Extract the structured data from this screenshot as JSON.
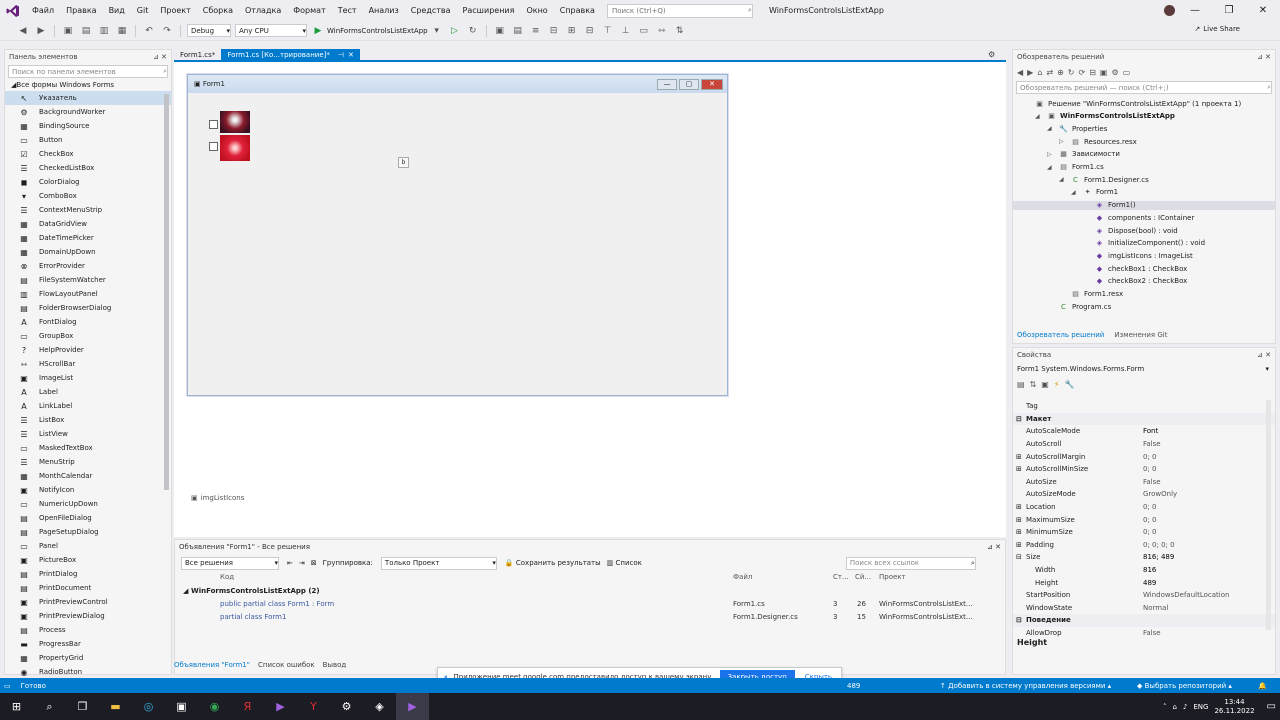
{
  "menu": [
    "Файл",
    "Правка",
    "Вид",
    "Git",
    "Проект",
    "Сборка",
    "Отладка",
    "Формат",
    "Тест",
    "Анализ",
    "Средства",
    "Расширения",
    "Окно",
    "Справка"
  ],
  "search": {
    "placeholder": "Поиск (Ctrl+Q)"
  },
  "app_title": "WinFormsControlsListExtApp",
  "window_controls": [
    "—",
    "❐",
    "✕"
  ],
  "toolbar": {
    "config": "Debug",
    "platform": "Any CPU",
    "run_label": "WinFormsControlsListExtApp",
    "live_share": "Live Share"
  },
  "toolbox": {
    "title": "Панель элементов",
    "search_placeholder": "Поиск по панели элементов",
    "group": "Все формы Windows Forms",
    "items": [
      "Указатель",
      "BackgroundWorker",
      "BindingSource",
      "Button",
      "CheckBox",
      "CheckedListBox",
      "ColorDialog",
      "ComboBox",
      "ContextMenuStrip",
      "DataGridView",
      "DateTimePicker",
      "DomainUpDown",
      "ErrorProvider",
      "FileSystemWatcher",
      "FlowLayoutPanel",
      "FolderBrowserDialog",
      "FontDialog",
      "GroupBox",
      "HelpProvider",
      "HScrollBar",
      "ImageList",
      "Label",
      "LinkLabel",
      "ListBox",
      "ListView",
      "MaskedTextBox",
      "MenuStrip",
      "MonthCalendar",
      "NotifyIcon",
      "NumericUpDown",
      "OpenFileDialog",
      "PageSetupDialog",
      "Panel",
      "PictureBox",
      "PrintDialog",
      "PrintDocument",
      "PrintPreviewControl",
      "PrintPreviewDialog",
      "Process",
      "ProgressBar",
      "PropertyGrid",
      "RadioButton"
    ],
    "icons": [
      "↖",
      "⚙",
      "▦",
      "▭",
      "☑",
      "☰",
      "◼",
      "▾",
      "☰",
      "▦",
      "▦",
      "▦",
      "⊗",
      "▤",
      "▥",
      "▤",
      "A",
      "▭",
      "?",
      "⇿",
      "▣",
      "A",
      "A",
      "☰",
      "☰",
      "▭",
      "☰",
      "▦",
      "▣",
      "▭",
      "▤",
      "▤",
      "▭",
      "▣",
      "▤",
      "▤",
      "▣",
      "▣",
      "▤",
      "▬",
      "▦",
      "◉"
    ]
  },
  "tabs": [
    {
      "label": "Form1.cs*"
    },
    {
      "label": "Form1.cs [Ко...трирование]*"
    }
  ],
  "form": {
    "title": "Form1",
    "tray_item": "imgListIcons",
    "center_glyph": "b"
  },
  "refs": {
    "header": "Объявления \"Form1\" - Все решения",
    "scope": "Все решения",
    "group_label": "Группировка:",
    "group_value": "Только Проект",
    "save_results": "Сохранить результаты",
    "list_label": "Список",
    "search_placeholder": "Поиск всех ссылок",
    "columns": {
      "code": "Код",
      "file": "Файл",
      "line": "Ст...",
      "col": "Сй...",
      "project": "Проект"
    },
    "project_row": "WinFormsControlsListExtApp (2)",
    "rows": [
      {
        "code": "public partial class Form1 : Form",
        "file": "Form1.cs",
        "line": "3",
        "col": "26",
        "project": "WinFormsControlsListExt..."
      },
      {
        "code": "partial class Form1",
        "file": "Form1.Designer.cs",
        "line": "3",
        "col": "15",
        "project": "WinFormsControlsListExt..."
      }
    ],
    "bottom_tabs": [
      "Объявления \"Form1\"",
      "Список ошибок",
      "Вывод"
    ]
  },
  "solution": {
    "title": "Обозреватель решений",
    "search_placeholder": "Обозреватель решений — поиск (Ctrl+;)",
    "nodes": [
      {
        "label": "Решение \"WinFormsControlsListExtApp\" (1 проекта 1)",
        "icon": "▣"
      },
      {
        "label": "WinFormsControlsListExtApp",
        "icon": "▣"
      },
      {
        "label": "Properties",
        "icon": "🔧"
      },
      {
        "label": "Resources.resx",
        "icon": "▤"
      },
      {
        "label": "Зависимости",
        "icon": "▦"
      },
      {
        "label": "Form1.cs",
        "icon": "▤"
      },
      {
        "label": "Form1.Designer.cs",
        "icon": "C"
      },
      {
        "label": "Form1",
        "icon": "✦"
      },
      {
        "label": "Form1()",
        "icon": "◈"
      },
      {
        "label": "components : IContainer",
        "icon": "◆"
      },
      {
        "label": "Dispose(bool) : void",
        "icon": "◈"
      },
      {
        "label": "InitializeComponent() : void",
        "icon": "◈"
      },
      {
        "label": "imgListIcons : ImageList",
        "icon": "◆"
      },
      {
        "label": "checkBox1 : CheckBox",
        "icon": "◆"
      },
      {
        "label": "checkBox2 : CheckBox",
        "icon": "◆"
      },
      {
        "label": "Form1.resx",
        "icon": "▤"
      },
      {
        "label": "Program.cs",
        "icon": "C"
      }
    ],
    "bottom_tabs": [
      "Обозреватель решений",
      "Изменения Git"
    ]
  },
  "properties": {
    "title": "Свойства",
    "object": "Form1  System.Windows.Forms.Form",
    "rows": [
      {
        "name": "Tag",
        "value": ""
      },
      {
        "name": "Макет",
        "value": "",
        "cat": true
      },
      {
        "name": "AutoScaleMode",
        "value": "Font"
      },
      {
        "name": "AutoScroll",
        "value": "False"
      },
      {
        "name": "AutoScrollMargin",
        "value": "0; 0"
      },
      {
        "name": "AutoScrollMinSize",
        "value": "0; 0"
      },
      {
        "name": "AutoSize",
        "value": "False"
      },
      {
        "name": "AutoSizeMode",
        "value": "GrowOnly"
      },
      {
        "name": "Location",
        "value": "0; 0"
      },
      {
        "name": "MaximumSize",
        "value": "0; 0"
      },
      {
        "name": "MinimumSize",
        "value": "0; 0"
      },
      {
        "name": "Padding",
        "value": "0; 0; 0; 0"
      },
      {
        "name": "Size",
        "value": "816; 489"
      },
      {
        "name": "Width",
        "value": "816"
      },
      {
        "name": "Height",
        "value": "489"
      },
      {
        "name": "StartPosition",
        "value": "WindowsDefaultLocation"
      },
      {
        "name": "WindowState",
        "value": "Normal"
      },
      {
        "name": "Поведение",
        "value": "",
        "cat": true
      },
      {
        "name": "AllowDrop",
        "value": "False"
      }
    ],
    "description": "Height"
  },
  "status": {
    "ready": "Готово",
    "num": "489",
    "vcs": "Добавить в систему управления версиями",
    "repo": "Выбрать репозиторий"
  },
  "notification": {
    "text": "Приложение meet.google.com предоставило доступ к вашему экрану.",
    "button": "Закрыть доступ",
    "link": "Скрыть"
  },
  "taskbar": {
    "lang": "ENG",
    "time": "13:44",
    "date": "26.11.2022"
  },
  "colors": {
    "accent": "#007acc",
    "taskbar": "#1c1c24"
  }
}
